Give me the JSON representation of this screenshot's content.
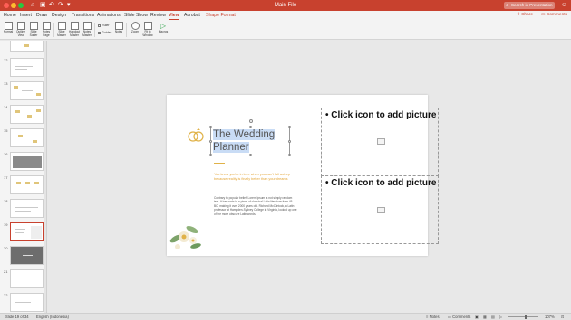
{
  "window": {
    "title": "Main File",
    "search_placeholder": "Search in Presentation",
    "quick_access": [
      "⌂",
      "▣",
      "↶",
      "↷",
      "▾"
    ]
  },
  "tabs": [
    {
      "label": "Home"
    },
    {
      "label": "Insert"
    },
    {
      "label": "Draw"
    },
    {
      "label": "Design"
    },
    {
      "label": "Transitions"
    },
    {
      "label": "Animations"
    },
    {
      "label": "Slide Show"
    },
    {
      "label": "Review"
    },
    {
      "label": "View"
    },
    {
      "label": "Acrobat"
    },
    {
      "label": "Shape Format"
    }
  ],
  "active_tab": "View",
  "share_label": "Share",
  "comments_label": "Comments",
  "ribbon": {
    "buttons": [
      {
        "label": "Normal"
      },
      {
        "label": "Outline View"
      },
      {
        "label": "Slide Sorter"
      },
      {
        "label": "Notes Page"
      },
      {
        "label": "Slide Master"
      },
      {
        "label": "Handout Master"
      },
      {
        "label": "Notes Master"
      },
      {
        "label": "Notes"
      },
      {
        "label": "Zoom"
      },
      {
        "label": "Fit to Window"
      },
      {
        "label": "Macros"
      }
    ],
    "checkboxes": [
      {
        "label": "Ruler"
      },
      {
        "label": "Guides"
      }
    ]
  },
  "thumbnails": [
    {
      "num": "12"
    },
    {
      "num": "13"
    },
    {
      "num": "14"
    },
    {
      "num": "15"
    },
    {
      "num": "16"
    },
    {
      "num": "17"
    },
    {
      "num": "18"
    },
    {
      "num": "19"
    },
    {
      "num": "20"
    },
    {
      "num": "21"
    },
    {
      "num": "22"
    }
  ],
  "selected_thumbnail": "19",
  "slide": {
    "title_line1": "The Wedding",
    "title_line2": "Planner",
    "subtitle": "You know you're in love when you can't fall asleep because reality is finally better than your dreams",
    "body": "Contrary to popular belief, Lorem Ipsum is not simply random text. It has roots in a piece of classical Latin literature from 45 BC, making it over 2000 years old. Richard McClintock, a Latin professor at Hampden-Sydney College in Virginia, looked up one of the more obscure Latin words.",
    "placeholder_1": "Click icon to add picture",
    "placeholder_2": "Click icon to add picture"
  },
  "status": {
    "slide_info": "Slide 19 of 34",
    "language": "English (Indonesia)",
    "notes": "Notes",
    "comments": "Comments",
    "zoom": "107%",
    "zoom_fraction": 0.6
  }
}
